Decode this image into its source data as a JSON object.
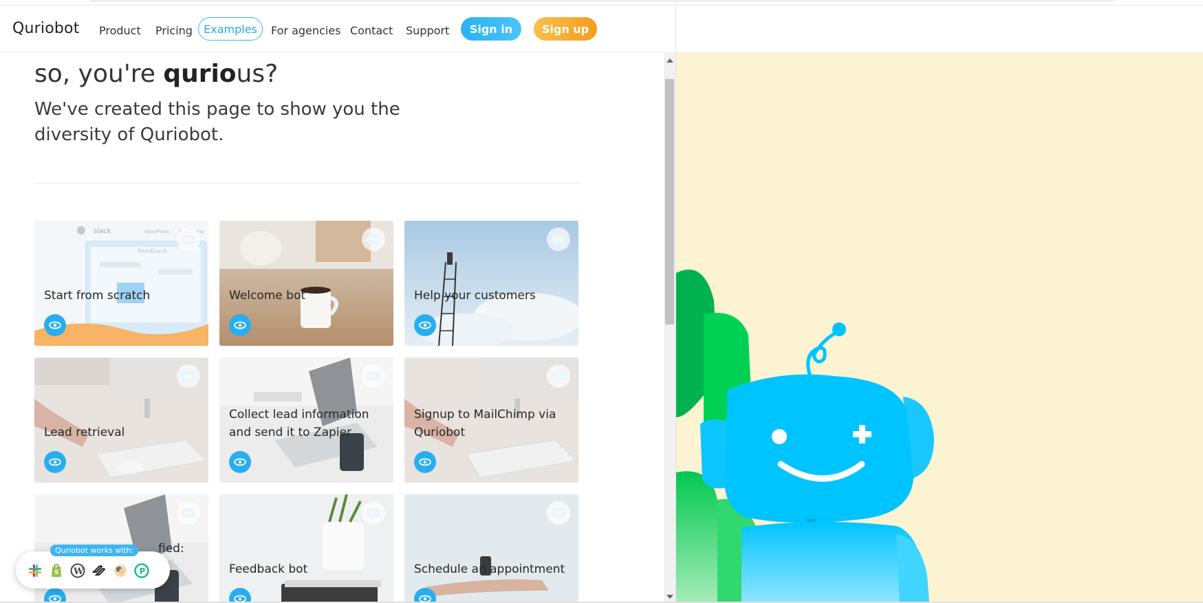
{
  "brand": "Quriobot",
  "nav": {
    "items": [
      "Product",
      "Pricing",
      "Examples",
      "For agencies",
      "Contact",
      "Support"
    ],
    "active": "Examples",
    "signin": "Sign in",
    "signup": "Sign up"
  },
  "hero": {
    "title_pre": "so, you're ",
    "title_bold": "qurio",
    "title_post": "us?",
    "subtitle": "We've created this page to show you the diversity of Quriobot."
  },
  "cards": [
    {
      "title": "Start from scratch"
    },
    {
      "title": "Welcome bot"
    },
    {
      "title": "Help your customers"
    },
    {
      "title": "Lead retrieval"
    },
    {
      "title": "Collect lead information and send it to Zapier"
    },
    {
      "title": "Signup to MailChimp via Quriobot"
    },
    {
      "title": "fied:"
    },
    {
      "title": "Feedback bot"
    },
    {
      "title": "Schedule an appointment"
    }
  ],
  "works_with": {
    "label": "Quriobot works with:",
    "icons": [
      "slack-icon",
      "shopify-icon",
      "wordpress-icon",
      "squarespace-icon",
      "mailchimp-icon",
      "producthunt-icon"
    ]
  },
  "colors": {
    "accent_blue": "#28aef0",
    "accent_orange": "#f39d1b",
    "robot_blue": "#00c4ff",
    "robot_green": "#00d155",
    "art_background": "#fcf3d3"
  }
}
